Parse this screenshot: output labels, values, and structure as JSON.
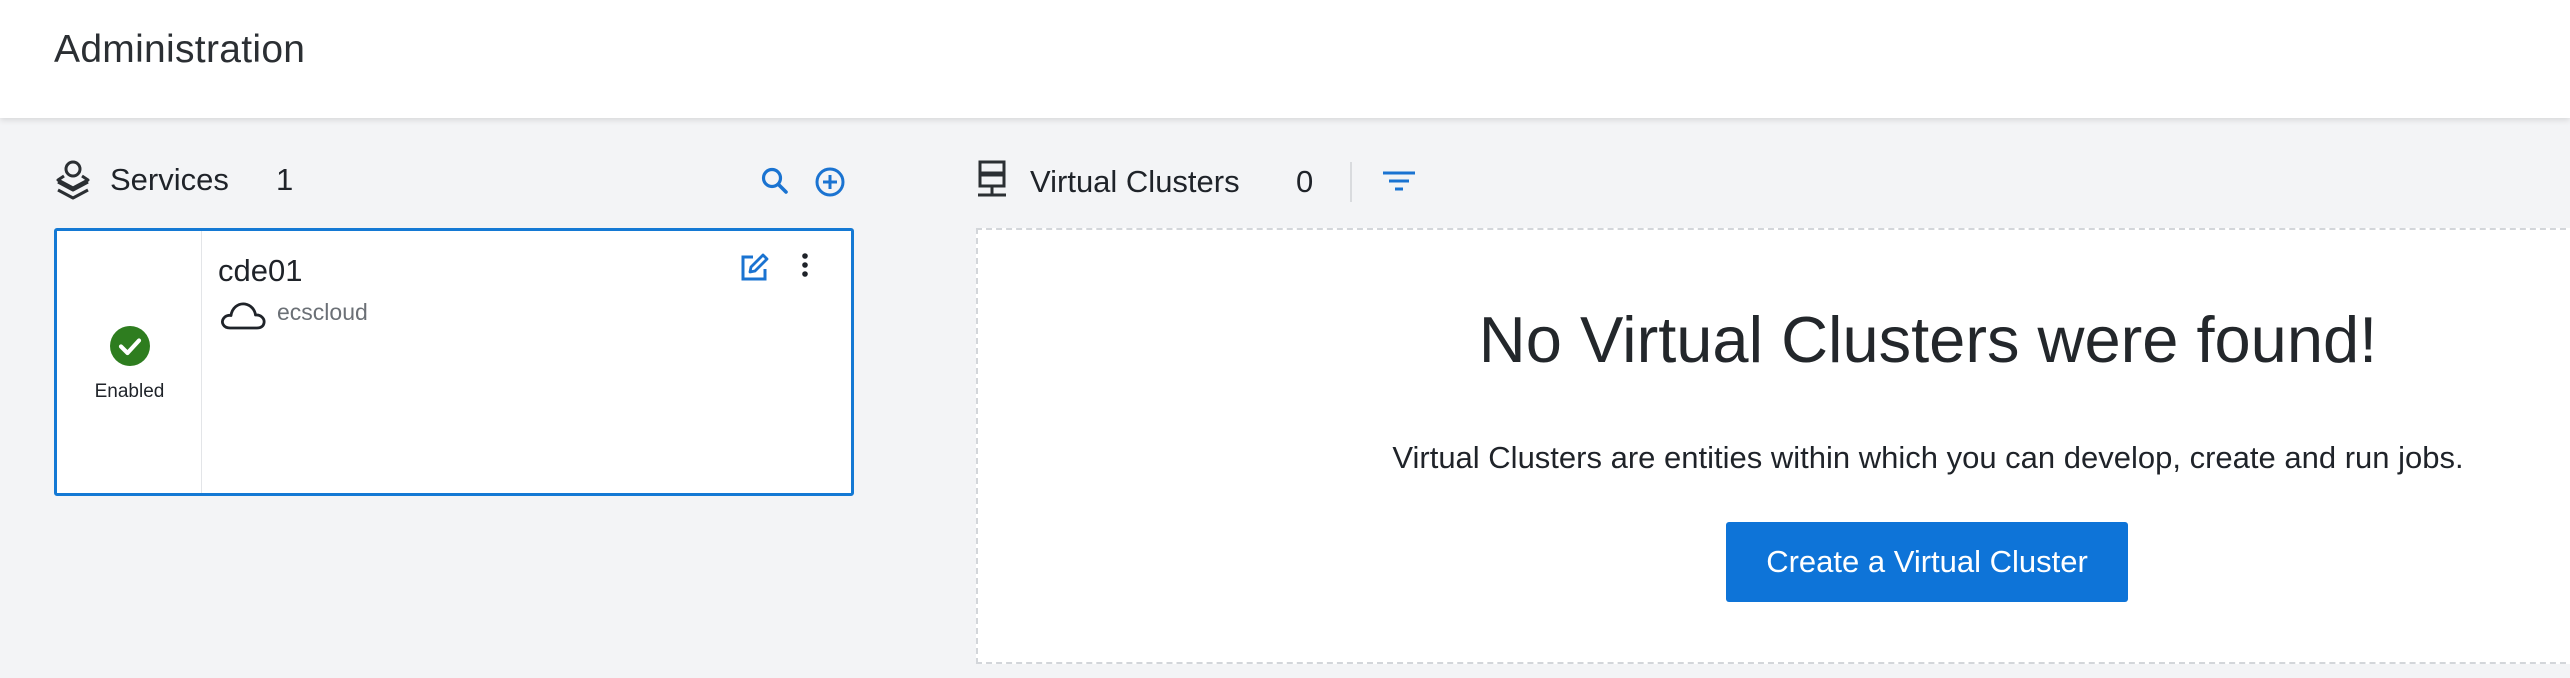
{
  "header": {
    "title": "Administration"
  },
  "services": {
    "title": "Services",
    "count": "1",
    "search_icon": "search-icon",
    "add_icon": "add-circle-icon",
    "items": [
      {
        "name": "cde01",
        "status": "Enabled",
        "status_color": "#2e7d1f",
        "cloud_icon": "cloud-icon",
        "cloud": "ecscloud"
      }
    ]
  },
  "virtual_clusters": {
    "title": "Virtual Clusters",
    "count": "0",
    "filter_icon": "filter-icon",
    "empty_title": "No Virtual Clusters were found!",
    "empty_desc": "Virtual Clusters are entities within which you can develop, create and run jobs.",
    "create_label": "Create a Virtual Cluster"
  },
  "colors": {
    "accent": "#0e74d8",
    "card_border": "#1479d4",
    "enabled": "#2e7d1f"
  }
}
